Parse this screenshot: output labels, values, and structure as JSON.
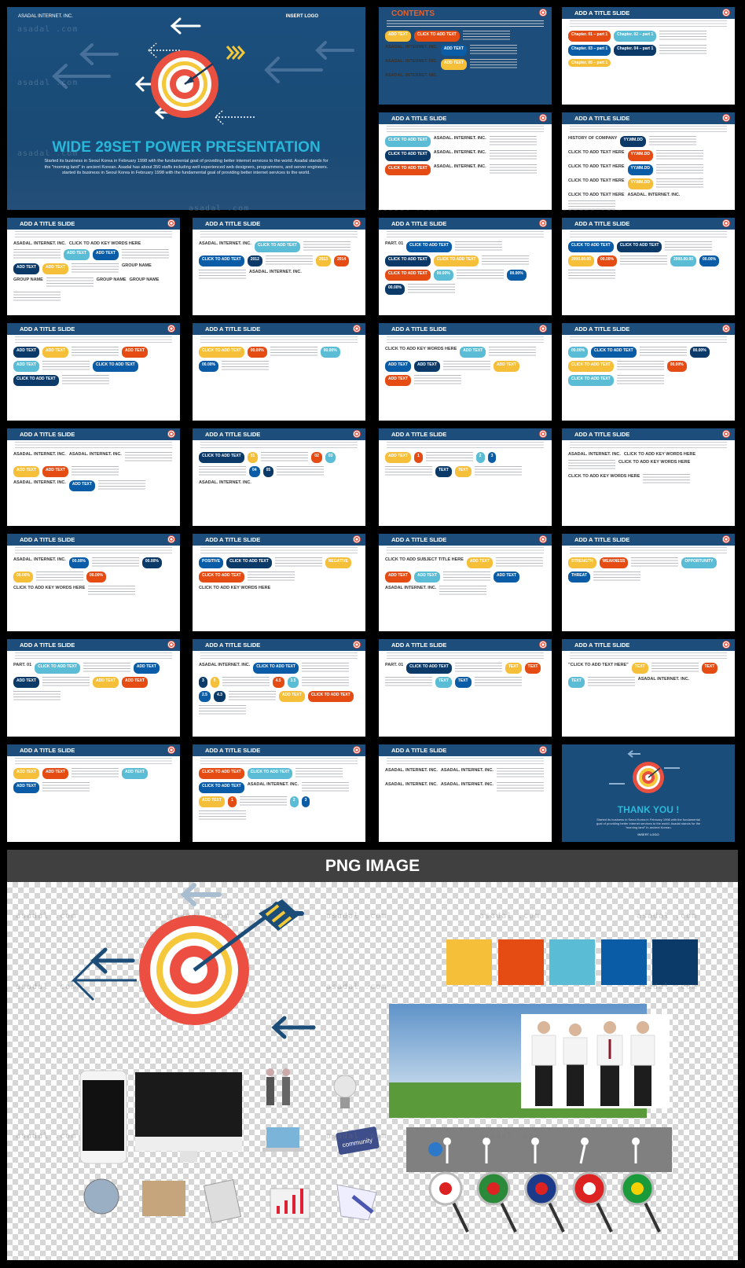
{
  "watermark": "asadal .com",
  "colors": {
    "header": "#1d4e7b",
    "yellow": "#f5bf3a",
    "orange": "#e44c14",
    "sky": "#5bbcd5",
    "blue": "#0a5ca6",
    "navy": "#0b3a68"
  },
  "hero": {
    "company": "ASADAL INTERNET. INC.",
    "logo": "INSERT  LOGO",
    "title": "WIDE 29SET POWER PRESENTATION",
    "description": "Started its business in Seoul Korea  in February 1998 with the fundamental goal of providing better internet services to the world. Asadal stands for the \"morning land\" in ancient Korean. Asadal has about 350 staffs including well experienced web designers, programmers, and server engineers. started its business in Seoul Korea  in February 1998 with the fundamental goal of providing better internet services to the world."
  },
  "top_slides": [
    {
      "title": "CONTENTS",
      "labels": [
        "ADD TEXT",
        "CLICK TO ADD TEXT",
        "ASADAL. INTERNET. INC.",
        "ADD TEXT",
        "ASADAL. INTERNET. INC.",
        "ADD TEXT",
        "ASADAL. INTERNET. INC."
      ]
    },
    {
      "title": "ADD A TITLE SLIDE",
      "labels": [
        "Chapter. 01 – part 1",
        "Chapter. 02 – part 1",
        "Chapter. 03 – part 1",
        "Chapter. 04 – part 1",
        "Chapter. 05 – part 1"
      ]
    },
    {
      "title": "ADD A TITLE SLIDE",
      "labels": [
        "CLICK TO ADD TEXT",
        "ASADAL. INTERNET. INC.",
        "CLICK TO ADD TEXT",
        "ASADAL. INTERNET. INC.",
        "CLICK TO ADD TEXT",
        "ASADAL. INTERNET. INC."
      ]
    },
    {
      "title": "ADD A TITLE SLIDE",
      "labels": [
        "HISTORY OF COMPANY",
        "YY.MM.DD",
        "CLICK TO ADD TEXT HERE",
        "YY.MM.DD",
        "CLICK TO ADD TEXT HERE",
        "YY.MM.DD",
        "CLICK TO ADD TEXT HERE",
        "YY.MM.DD",
        "CLICK TO ADD TEXT HERE",
        "ASADAL. INTERNET. INC."
      ]
    }
  ],
  "slides": [
    {
      "title": "ADD A TITLE SLIDE",
      "labels": [
        "ASADAL. INTERNET. INC.",
        "CLICK TO ADD KEY WORDS HERE",
        "ADD TEXT",
        "ADD TEXT",
        "ADD TEXT",
        "ADD TEXT",
        "GROUP NAME",
        "GROUP NAME",
        "GROUP NAME",
        "GROUP NAME"
      ]
    },
    {
      "title": "ADD A TITLE SLIDE",
      "labels": [
        "ASADAL. INTERNET. INC.",
        "CLICK TO ADD TEXT",
        "CLICK TO ADD TEXT",
        "2012",
        "2013",
        "2014",
        "ASADAL. INTERNET. INC."
      ]
    },
    {
      "title": "ADD A TITLE SLIDE",
      "labels": [
        "PART. 01",
        "CLICK TO ADD TEXT",
        "CLICK TO ADD TEXT",
        "CLICK TO ADD TEXT",
        "CLICK TO ADD TEXT",
        "00.00%",
        "00.00%",
        "00.00%"
      ]
    },
    {
      "title": "ADD A TITLE SLIDE",
      "labels": [
        "CLICK TO ADD TEXT",
        "CLICK TO ADD TEXT",
        "2000.00.00",
        "00.00%",
        "2000.00.00",
        "00.00%"
      ]
    },
    {
      "title": "ADD A TITLE SLIDE",
      "labels": [
        "ADD TEXT",
        "ADD TEXT",
        "ADD TEXT",
        "ADD TEXT",
        "CLICK TO ADD TEXT",
        "CLICK TO ADD TEXT"
      ]
    },
    {
      "title": "ADD A TITLE SLIDE",
      "labels": [
        "CLICK TO ADD TEXT",
        "00.00%",
        "00.00%",
        "00.00%"
      ]
    },
    {
      "title": "ADD A TITLE SLIDE",
      "labels": [
        "CLICK TO ADD  KEY WORDS HERE",
        "ADD TEXT",
        "ADD TEXT",
        "ADD TEXT",
        "ADD TEXT",
        "ADD TEXT"
      ]
    },
    {
      "title": "ADD A TITLE SLIDE",
      "labels": [
        "00.00%",
        "CLICK TO ADD TEXT",
        "00.00%",
        "CLICK TO ADD TEXT",
        "00.00%",
        "CLICK TO ADD TEXT"
      ]
    },
    {
      "title": "ADD A TITLE SLIDE",
      "labels": [
        "ASADAL. INTERNET. INC.",
        "ASADAL. INTERNET. INC.",
        "ADD TEXT",
        "ADD TEXT",
        "ASADAL. INTERNET. INC.",
        "ADD TEXT"
      ]
    },
    {
      "title": "ADD A TITLE SLIDE",
      "labels": [
        "CLICK TO ADD TEXT",
        "01",
        "02",
        "03",
        "04",
        "05",
        "ASADAL. INTERNET. INC."
      ]
    },
    {
      "title": "ADD A TITLE SLIDE",
      "labels": [
        "ADD TEXT",
        "1",
        "2",
        "3",
        "TEXT",
        "TEXT"
      ]
    },
    {
      "title": "ADD A TITLE SLIDE",
      "labels": [
        "ASADAL. INTERNET. INC.",
        "CLICK TO ADD KEY WORDS HERE",
        "CLICK TO ADD KEY WORDS HERE",
        "CLICK TO ADD KEY WORDS HERE"
      ]
    },
    {
      "title": "ADD A TITLE SLIDE",
      "labels": [
        "ASADAL. INTERNET. INC.",
        "00.00%",
        "00.00%",
        "00.00%",
        "00.00%",
        "CLICK TO ADD KEY WORDS HERE"
      ]
    },
    {
      "title": "ADD A TITLE SLIDE",
      "labels": [
        "POSITIVE",
        "CLICK TO ADD TEXT",
        "NEGATIVE",
        "CLICK TO ADD TEXT",
        "CLICK TO ADD KEY WORDS HERE"
      ]
    },
    {
      "title": "ADD A TITLE SLIDE",
      "labels": [
        "CLICK TO ADD SUBJECT TITLE HERE",
        "ADD TEXT",
        "ADD TEXT",
        "ADD TEXT",
        "ADD TEXT",
        "ASADAL INTERNET. INC."
      ]
    },
    {
      "title": "ADD A TITLE SLIDE",
      "labels": [
        "STRENGTH",
        "WEAKNESS",
        "OPPORTUNITY",
        "THREAT"
      ]
    },
    {
      "title": "ADD A TITLE SLIDE",
      "labels": [
        "PART. 01",
        "CLICK TO ADD TEXT",
        "ADD TEXT",
        "ADD TEXT",
        "ADD TEXT",
        "ADD TEXT"
      ]
    },
    {
      "title": "ADD A TITLE SLIDE",
      "labels": [
        "ASADAL INTERNET. INC.",
        "CLICK TO ADD TEXT",
        "3",
        "5",
        "4.5",
        "3.5",
        "2.5",
        "4.3",
        "ADD TEXT",
        "CLICK TO ADD TEXT"
      ]
    },
    {
      "title": "ADD A TITLE SLIDE",
      "labels": [
        "PART. 01",
        "CLICK TO ADD TEXT",
        "TEXT",
        "TEXT",
        "TEXT",
        "TEXT"
      ]
    },
    {
      "title": "ADD A TITLE SLIDE",
      "labels": [
        "\"CLICK TO ADD TEXT HERE\"",
        "TEXT",
        "TEXT",
        "TEXT",
        "ASADAL INTERNET. INC."
      ]
    },
    {
      "title": "ADD A TITLE SLIDE",
      "labels": [
        "ADD TEXT",
        "ADD TEXT",
        "ADD TEXT",
        "ADD TEXT"
      ]
    },
    {
      "title": "ADD A TITLE SLIDE",
      "labels": [
        "CLICK TO ADD TEXT",
        "CLICK TO ADD TEXT",
        "CLICK TO ADD TEXT",
        "ASADAL INTERNET. INC.",
        "ADD TEXT",
        "1",
        "2",
        "3"
      ]
    },
    {
      "title": "ADD A TITLE SLIDE",
      "labels": [
        "ASADAL. INTERNET. INC.",
        "ASADAL. INTERNET. INC.",
        "ASADAL. INTERNET. INC.",
        "ASADAL. INTERNET. INC."
      ]
    }
  ],
  "thank_you": {
    "title": "THANK YOU !",
    "description": "Started its business in Seoul Korea in February 1998 with the fundamental goal of providing better internet services to the world. Asadal stands for the \"morning land\" in ancient Korean.",
    "logo": "INSERT LOGO"
  },
  "png_section": {
    "title": "PNG IMAGE",
    "swatches": [
      "#f5bf3a",
      "#e44c14",
      "#5bbcd5",
      "#0a5ca6",
      "#0b3a68"
    ],
    "community_label": "community",
    "flags": [
      "korea",
      "algeria",
      "australia",
      "usa",
      "brazil"
    ]
  }
}
